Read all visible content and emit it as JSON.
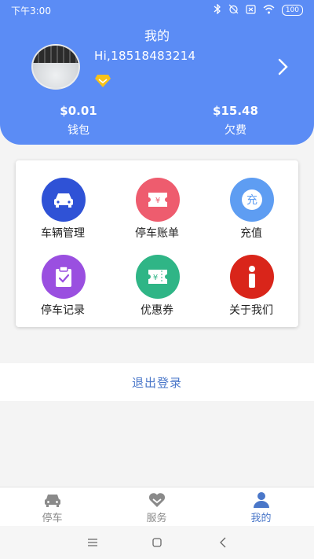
{
  "status_bar": {
    "time": "下午3:00",
    "battery": "100"
  },
  "header": {
    "title": "我的",
    "greeting": "Hi,18518483214",
    "wallet": {
      "amount": "$0.01",
      "label": "钱包"
    },
    "arrears": {
      "amount": "$15.48",
      "label": "欠费"
    }
  },
  "menu": [
    {
      "label": "车辆管理",
      "icon": "car-icon",
      "color": "#2f52d6"
    },
    {
      "label": "停车账单",
      "icon": "yen-ticket-icon",
      "color": "#ee5c6e",
      "glyph": "¥"
    },
    {
      "label": "充值",
      "icon": "recharge-icon",
      "color": "#5e9df2",
      "glyph": "充"
    },
    {
      "label": "停车记录",
      "icon": "clipboard-check-icon",
      "color": "#9a4fe0"
    },
    {
      "label": "优惠券",
      "icon": "coupon-icon",
      "color": "#2fb586",
      "glyph": "¥"
    },
    {
      "label": "关于我们",
      "icon": "info-icon",
      "color": "#d9251a"
    }
  ],
  "logout_label": "退出登录",
  "tabs": [
    {
      "label": "停车",
      "icon": "car-icon",
      "active": false
    },
    {
      "label": "服务",
      "icon": "heart-icon",
      "active": false
    },
    {
      "label": "我的",
      "icon": "user-icon",
      "active": true
    }
  ],
  "colors": {
    "header_bg": "#5b8cf5",
    "tab_active": "#4a77c9",
    "tab_inactive": "#8a8a8a"
  }
}
